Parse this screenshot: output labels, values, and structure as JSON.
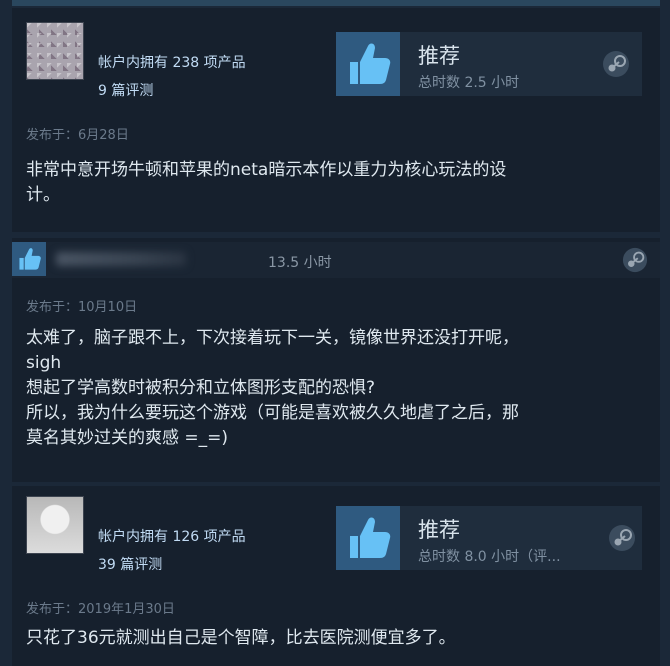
{
  "reviews": [
    {
      "owned": "帐户内拥有 238 项产品",
      "reviews_count": "9 篇评测",
      "recommendation": "推荐",
      "hours": "总时数 2.5 小时",
      "posted": "发布于：6月28日",
      "text_lines": [
        "非常中意开场牛顿和苹果的neta暗示本作以重力为核心玩法的设",
        "计。"
      ]
    },
    {
      "hours": "13.5 小时",
      "posted": "发布于：10月10日",
      "text_lines": [
        "太难了，脑子跟不上，下次接着玩下一关，镜像世界还没打开呢，",
        "sigh",
        "想起了学高数时被积分和立体图形支配的恐惧?",
        "所以，我为什么要玩这个游戏（可能是喜欢被久久地虐了之后，那",
        "莫名其妙过关的爽感 =_=)"
      ]
    },
    {
      "owned": "帐户内拥有 126 项产品",
      "reviews_count": "39 篇评测",
      "recommendation": "推荐",
      "hours": "总时数 8.0 小时（评...",
      "posted": "发布于：2019年1月30日",
      "text_lines": [
        "只花了36元就测出自己是个智障，比去医院测便宜多了。"
      ]
    }
  ],
  "icons": {
    "thumb": "thumbs-up-icon",
    "steam": "steam-logo-icon"
  },
  "colors": {
    "background": "#1b2838",
    "card": "#16202d",
    "accent": "#67c1f5"
  }
}
